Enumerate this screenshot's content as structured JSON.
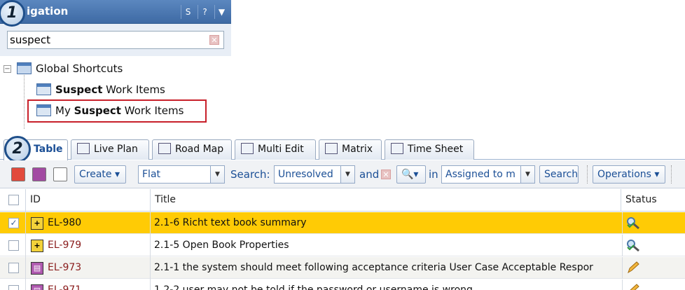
{
  "navigation": {
    "title": "igation",
    "search_value": "suspect",
    "header_buttons": [
      "S",
      "?",
      "▼"
    ]
  },
  "badges": {
    "one": "1",
    "two": "2"
  },
  "tree": {
    "root": "Global Shortcuts",
    "items": [
      {
        "bold": "Suspect",
        "rest": " Work Items"
      },
      {
        "prefix": "My ",
        "bold": "Suspect",
        "rest": " Work Items"
      }
    ]
  },
  "tabs": [
    "Table",
    "Live Plan",
    "Road Map",
    "Multi Edit",
    "Matrix",
    "Time Sheet"
  ],
  "toolbar": {
    "create": "Create",
    "view": "Flat",
    "search_label": "Search:",
    "status_filter": "Unresolved",
    "and_label": "and",
    "in_label": "in",
    "assignee_filter": "Assigned to m",
    "search_button": "Search",
    "operations": "Operations"
  },
  "table": {
    "headers": {
      "id": "ID",
      "title": "Title",
      "status": "Status"
    },
    "rows": [
      {
        "id": "EL-980",
        "title": "2.1-6 Richt text book summary",
        "selected": true,
        "type": "yellow",
        "status": "search-check"
      },
      {
        "id": "EL-979",
        "title": "2.1-5 Open Book Properties",
        "selected": false,
        "type": "yellow",
        "status": "search-check"
      },
      {
        "id": "EL-973",
        "title": "2.1-1 the system should meet following acceptance criteria User Case Acceptable Respor",
        "selected": false,
        "type": "purple",
        "status": "pencil"
      },
      {
        "id": "EL-971",
        "title": "1.2-2 user may not be told if the password or username is wrong",
        "selected": false,
        "type": "purple",
        "status": "pencil"
      }
    ]
  },
  "colors": {
    "selected_row": "#ffcb05",
    "accent": "#1b4f96",
    "highlight_box": "#c8202a"
  }
}
